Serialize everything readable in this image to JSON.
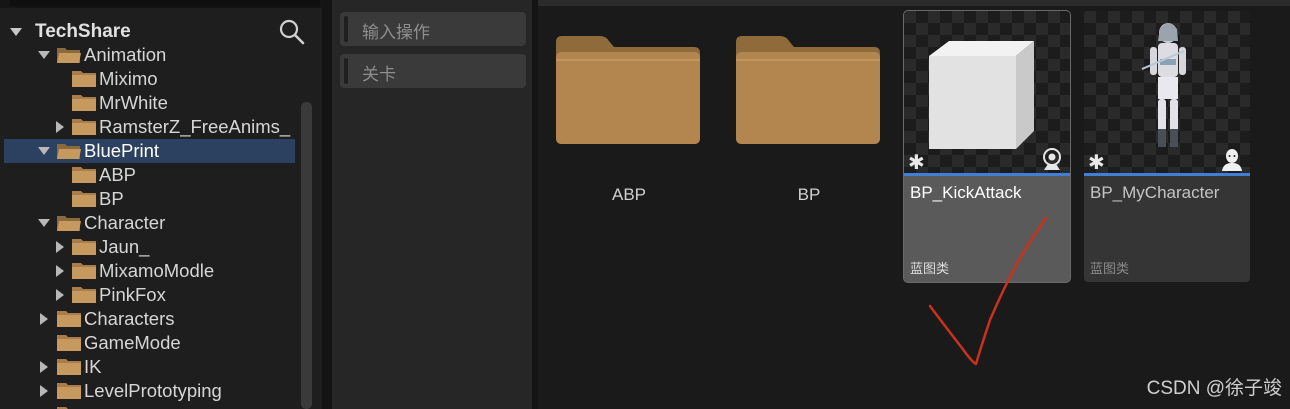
{
  "tree": {
    "root": "TechShare",
    "items": [
      {
        "label": "Animation"
      },
      {
        "label": "Miximo"
      },
      {
        "label": "MrWhite"
      },
      {
        "label": "RamsterZ_FreeAnims_"
      },
      {
        "label": "BluePrint"
      },
      {
        "label": "ABP"
      },
      {
        "label": "BP"
      },
      {
        "label": "Character"
      },
      {
        "label": "Jaun_"
      },
      {
        "label": "MixamoModle"
      },
      {
        "label": "PinkFox"
      },
      {
        "label": "Characters"
      },
      {
        "label": "GameMode"
      },
      {
        "label": "IK"
      },
      {
        "label": "LevelPrototyping"
      }
    ]
  },
  "middle": {
    "items": [
      {
        "label": "输入操作"
      },
      {
        "label": "关卡"
      }
    ]
  },
  "content": {
    "folders": [
      {
        "label": "ABP"
      },
      {
        "label": "BP"
      }
    ],
    "assets": [
      {
        "name": "BP_KickAttack",
        "type": "蓝图类",
        "icon": "camera-icon"
      },
      {
        "name": "BP_MyCharacter",
        "type": "蓝图类",
        "icon": "person-icon"
      }
    ]
  },
  "watermark": "CSDN @徐子竣",
  "colors": {
    "selection": "#2c4160",
    "accent_line": "#3f7fd8",
    "folder": "#a87d4a",
    "annotation": "#c8321e"
  }
}
